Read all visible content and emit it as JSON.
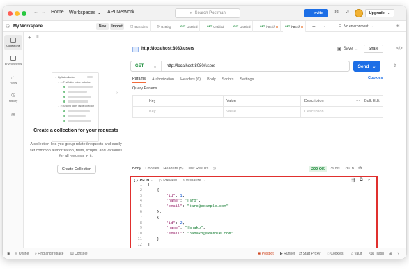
{
  "titlebar": {
    "nav": {
      "home": "Home",
      "workspaces": "Workspaces",
      "api_network": "API Network"
    },
    "search_placeholder": "Search Postman",
    "invite": "Invite",
    "upgrade": "Upgrade"
  },
  "workspace": {
    "name": "My Workspace",
    "new_label": "New",
    "import_label": "Import"
  },
  "tabs": [
    {
      "method": "",
      "label": "Overview"
    },
    {
      "method": "",
      "label": "Getting"
    },
    {
      "method": "GET",
      "label": "Untitled"
    },
    {
      "method": "GET",
      "label": "Untitled"
    },
    {
      "method": "GET",
      "label": "Untitled"
    },
    {
      "method": "GET",
      "label": "http://l"
    },
    {
      "method": "GET",
      "label": "http://l"
    }
  ],
  "environment": "No environment",
  "rail": [
    {
      "label": "Collections"
    },
    {
      "label": "Environments"
    },
    {
      "label": "Flows"
    },
    {
      "label": "History"
    }
  ],
  "illustration": {
    "collection": "My first collection",
    "folder1": "First folder inside collection",
    "folder2": "Second folder inside collection"
  },
  "cta": {
    "title": "Create a collection for your requests",
    "description": "A collection lets you group related requests and easily set common authorization, tests, scripts, and variables for all requests in it.",
    "button": "Create Collection"
  },
  "request": {
    "title": "http://localhost:8080/users",
    "method": "GET",
    "url": "http://localhost:8080/users",
    "save": "Save",
    "share": "Share",
    "send": "Send",
    "tabs": [
      "Params",
      "Authorization",
      "Headers (6)",
      "Body",
      "Scripts",
      "Settings"
    ],
    "cookies": "Cookies",
    "query_params_title": "Query Params",
    "table_headers": {
      "key": "Key",
      "value": "Value",
      "description": "Description",
      "bulk_edit": "Bulk Edit"
    },
    "table_placeholders": {
      "key": "Key",
      "value": "Value",
      "description": "Description"
    }
  },
  "response": {
    "tabs": [
      "Body",
      "Cookies",
      "Headers (5)",
      "Test Results"
    ],
    "status": "200 OK",
    "time": "39 ms",
    "size": "269 B",
    "format": "JSON",
    "preview": "Preview",
    "visualize": "Visualize",
    "code_lines": [
      [
        {
          "t": "p",
          "v": "["
        }
      ],
      [
        {
          "t": "p",
          "v": "    {"
        }
      ],
      [
        {
          "t": "p",
          "v": "        "
        },
        {
          "t": "k",
          "v": "\"id\""
        },
        {
          "t": "p",
          "v": ": "
        },
        {
          "t": "n",
          "v": "1"
        },
        {
          "t": "p",
          "v": ","
        }
      ],
      [
        {
          "t": "p",
          "v": "        "
        },
        {
          "t": "k",
          "v": "\"name\""
        },
        {
          "t": "p",
          "v": ": "
        },
        {
          "t": "s",
          "v": "\"Taro\""
        },
        {
          "t": "p",
          "v": ","
        }
      ],
      [
        {
          "t": "p",
          "v": "        "
        },
        {
          "t": "k",
          "v": "\"email\""
        },
        {
          "t": "p",
          "v": ": "
        },
        {
          "t": "s",
          "v": "\"taro@example.com\""
        }
      ],
      [
        {
          "t": "p",
          "v": "    },"
        }
      ],
      [
        {
          "t": "p",
          "v": "    {"
        }
      ],
      [
        {
          "t": "p",
          "v": "        "
        },
        {
          "t": "k",
          "v": "\"id\""
        },
        {
          "t": "p",
          "v": ": "
        },
        {
          "t": "n",
          "v": "2"
        },
        {
          "t": "p",
          "v": ","
        }
      ],
      [
        {
          "t": "p",
          "v": "        "
        },
        {
          "t": "k",
          "v": "\"name\""
        },
        {
          "t": "p",
          "v": ": "
        },
        {
          "t": "s",
          "v": "\"Hanako\""
        },
        {
          "t": "p",
          "v": ","
        }
      ],
      [
        {
          "t": "p",
          "v": "        "
        },
        {
          "t": "k",
          "v": "\"email\""
        },
        {
          "t": "p",
          "v": ": "
        },
        {
          "t": "s",
          "v": "\"hanako@example.com\""
        }
      ],
      [
        {
          "t": "p",
          "v": "    }"
        }
      ],
      [
        {
          "t": "p",
          "v": "]"
        }
      ]
    ]
  },
  "footer": {
    "online": "Online",
    "find_replace": "Find and replace",
    "console": "Console",
    "postbot": "Postbot",
    "runner": "Runner",
    "start_proxy": "Start Proxy",
    "cookies": "Cookies",
    "vault": "Vault",
    "trash": "Trash"
  },
  "colors": {
    "accent": "#1c6ee6",
    "highlight_box": "#e0302e",
    "status_ok": "#1b8a39"
  }
}
